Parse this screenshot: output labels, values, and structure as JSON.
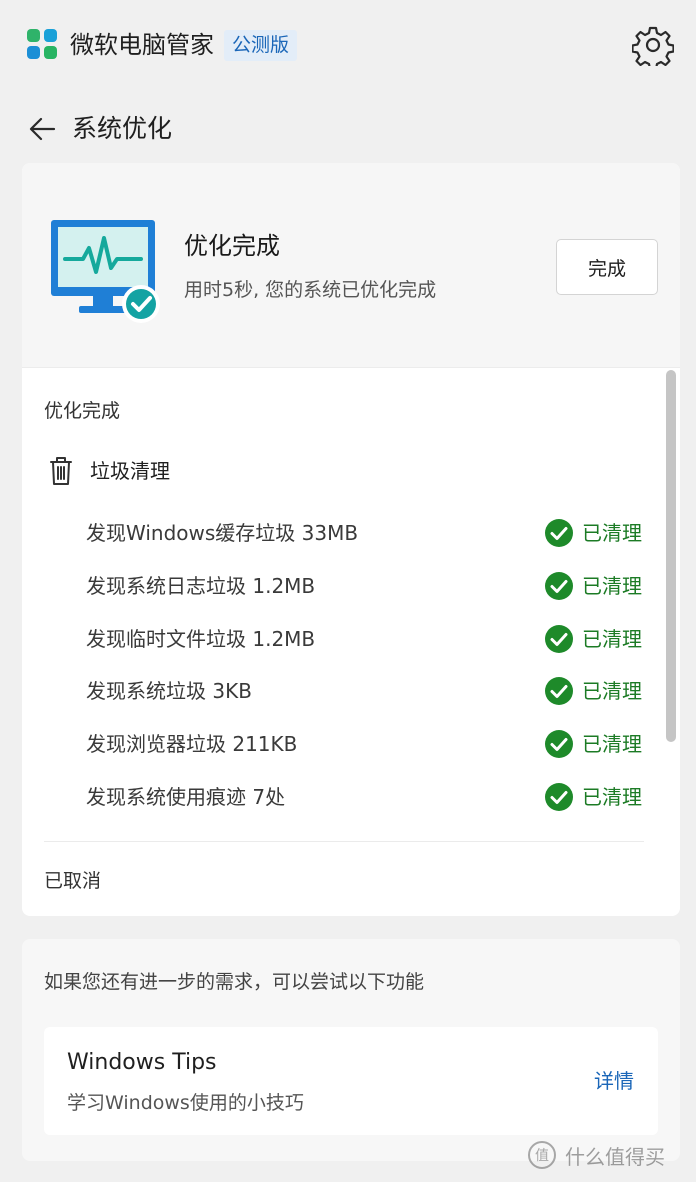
{
  "app": {
    "title": "微软电脑管家",
    "badge": "公测版"
  },
  "header": {
    "page_title": "系统优化"
  },
  "summary": {
    "title": "优化完成",
    "subtitle": "用时5秒, 您的系统已优化完成",
    "done_button": "完成"
  },
  "results": {
    "section_label": "优化完成",
    "category": "垃圾清理",
    "items": [
      {
        "text": "发现Windows缓存垃圾 33MB",
        "status": "已清理"
      },
      {
        "text": "发现系统日志垃圾 1.2MB",
        "status": "已清理"
      },
      {
        "text": "发现临时文件垃圾 1.2MB",
        "status": "已清理"
      },
      {
        "text": "发现系统垃圾 3KB",
        "status": "已清理"
      },
      {
        "text": "发现浏览器垃圾 211KB",
        "status": "已清理"
      },
      {
        "text": "发现系统使用痕迹 7处",
        "status": "已清理"
      }
    ],
    "cancelled_label": "已取消"
  },
  "suggestions": {
    "text": "如果您还有进一步的需求，可以尝试以下功能",
    "tip": {
      "title": "Windows Tips",
      "subtitle": "学习Windows使用的小技巧",
      "link": "详情"
    }
  },
  "watermark": {
    "text": "什么值得买"
  },
  "colors": {
    "accent_blue": "#1a66b8",
    "success_green": "#1c7b25",
    "check_circle": "#1e8a2a",
    "monitor_blue": "#1f7fd6",
    "monitor_screen": "#d4f1ef",
    "badge_teal": "#14a3a3"
  },
  "icons": {
    "logo": "app-logo-icon",
    "settings": "gear-icon",
    "back": "arrow-left-icon",
    "monitor": "monitor-check-icon",
    "trash": "trash-icon",
    "check": "check-circle-icon"
  }
}
